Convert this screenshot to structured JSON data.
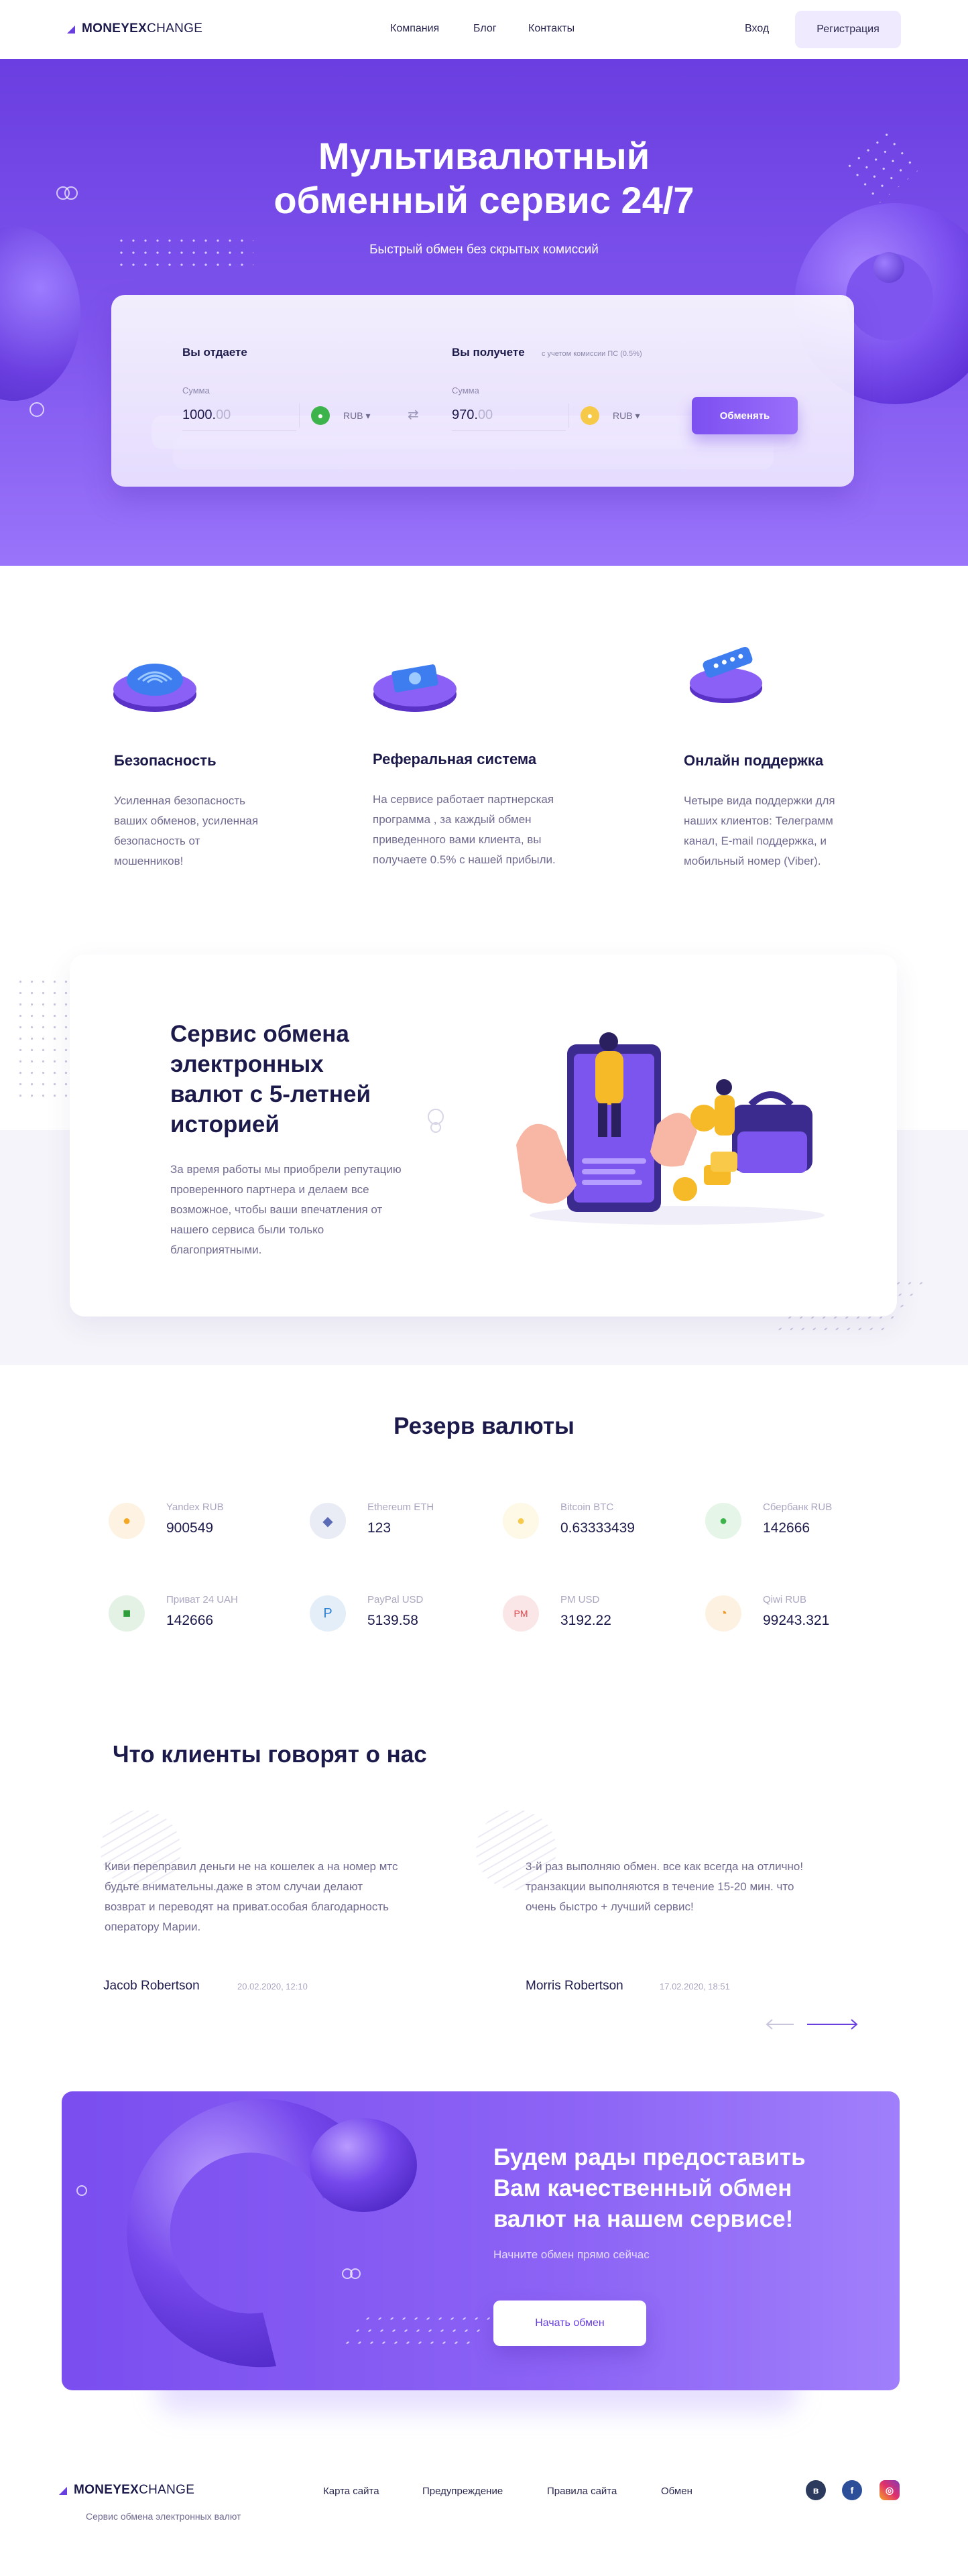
{
  "header": {
    "logo_bold": "MONEYEX",
    "logo_light": "CHANGE",
    "nav": [
      "Компания",
      "Блог",
      "Контакты"
    ],
    "login": "Вход",
    "register": "Регистрация"
  },
  "hero": {
    "title_line1": "Мультивалютный",
    "title_line2": "обменный сервис 24/7",
    "subtitle": "Быстрый обмен без скрытых комиссий"
  },
  "exchange": {
    "give_label": "Вы отдаете",
    "get_label": "Вы получете",
    "get_note": "с учетом комиссии ПС (0.5%)",
    "amount_label": "Сумма",
    "give_amount_main": "1000.",
    "give_amount_fade": "00",
    "get_amount_main": "970.",
    "get_amount_fade": "00",
    "give_currency": "RUB",
    "get_currency": "RUB",
    "button": "Обменять"
  },
  "features": [
    {
      "title": "Безопасность",
      "text_lines": [
        "Усиленная безопасность",
        "ваших обменов, усиленная",
        "безопасность от",
        "мошенников!"
      ],
      "icon": "fingerprint-icon"
    },
    {
      "title": "Реферальная система",
      "text_lines": [
        "На сервисе работает партнерская",
        "программа , за каждый обмен",
        "приведенного вами клиента, вы",
        "получаете 0.5% с нашей прибыли."
      ],
      "icon": "money-icon"
    },
    {
      "title": "Онлайн поддержка",
      "text_lines": [
        "Четыре вида поддержки для",
        "наших клиентов:  Телеграмм",
        "канал, E-mail поддержка, и",
        "мобильный номер (Viber)."
      ],
      "icon": "chat-icon"
    }
  ],
  "service": {
    "title_lines": [
      "Сервис обмена",
      "электронных",
      "валют с 5-летней",
      "историей"
    ],
    "text_lines": [
      "За время работы мы приобрели репутацию",
      "проверенного партнера и делаем все",
      "возможное, чтобы ваши впечатления от",
      "нашего сервиса были только",
      "благоприятными."
    ]
  },
  "reserve": {
    "title": "Резерв валюты",
    "items": [
      {
        "name": "Yandex RUB",
        "value": "900549",
        "icon": "yandex-icon",
        "color": "#f5a623"
      },
      {
        "name": "Ethereum ETH",
        "value": "123",
        "icon": "ethereum-icon",
        "color": "#5b6bb5"
      },
      {
        "name": "Bitcoin BTC",
        "value": "0.63333439",
        "icon": "bitcoin-icon",
        "color": "#f7c948"
      },
      {
        "name": "Сбербанк  RUB",
        "value": "142666",
        "icon": "sberbank-icon",
        "color": "#3cb44b"
      },
      {
        "name": "Приват 24 UAH",
        "value": "142666",
        "icon": "privat24-icon",
        "color": "#2f9e3a"
      },
      {
        "name": "PayPal USD",
        "value": "5139.58",
        "icon": "paypal-icon",
        "color": "#2a7fd4"
      },
      {
        "name": "PM USD",
        "value": "3192.22",
        "icon": "pm-icon",
        "color": "#e2474b",
        "glyph": "PM"
      },
      {
        "name": "Qiwi RUB",
        "value": "99243.321",
        "icon": "qiwi-icon",
        "color": "#f39a1e"
      }
    ]
  },
  "reviews": {
    "title": "Что клиенты говорят о нас",
    "items": [
      {
        "text_lines": [
          "Киви переправил деньги не на кошелек а на номер мтс",
          "будьте внимательны.даже в этом случаи делают",
          "возврат и переводят на приват.особая благодарность",
          "оператору Марии."
        ],
        "name": "Jacob Robertson",
        "date": "20.02.2020, 12:10"
      },
      {
        "text_lines": [
          "3-й раз выполняю обмен. все как всегда на отлично!",
          "транзакции выполняются в течение 15-20 мин. что",
          "очень быстро + лучший сервис!"
        ],
        "name": "Morris Robertson",
        "date": "17.02.2020, 18:51"
      }
    ]
  },
  "cta": {
    "title_lines": [
      "Будем рады предоставить",
      "Вам качественный обмен",
      "валют на нашем сервисе!"
    ],
    "subtitle": "Начните обмен прямо сейчас",
    "button": "Начать обмен"
  },
  "footer": {
    "logo_bold": "MONEYEX",
    "logo_light": "CHANGE",
    "tagline": "Сервис обмена электронных валют",
    "links": [
      "Карта сайта",
      "Предупреждение",
      "Правила сайта",
      "Обмен"
    ],
    "social": [
      "vk-icon",
      "facebook-icon",
      "instagram-icon"
    ]
  },
  "colors": {
    "brand": "#6a3fe0",
    "dark": "#1c1a4a",
    "muted": "#6f6b90"
  }
}
